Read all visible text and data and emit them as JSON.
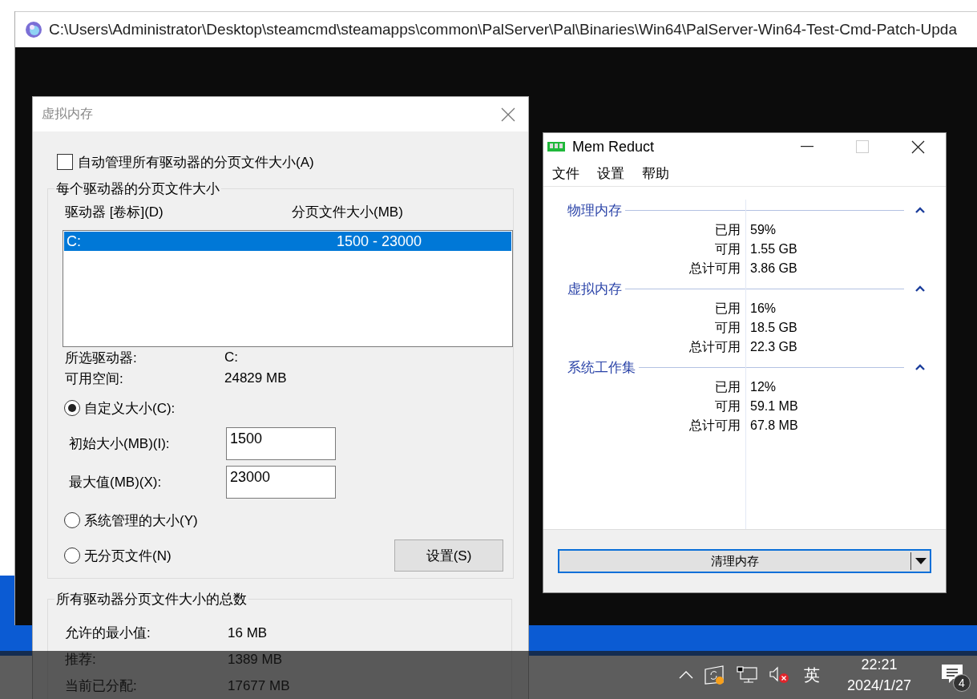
{
  "console_window": {
    "title": "C:\\Users\\Administrator\\Desktop\\steamcmd\\steamapps\\common\\PalServer\\Pal\\Binaries\\Win64\\PalServer-Win64-Test-Cmd-Patch-Upda"
  },
  "virtual_memory_dialog": {
    "title": "虚拟内存",
    "auto_manage": {
      "label": "自动管理所有驱动器的分页文件大小(A)",
      "checked": false
    },
    "per_drive": {
      "title": "每个驱动器的分页文件大小",
      "columns": [
        "驱动器 [卷标](D)",
        "分页文件大小(MB)"
      ],
      "rows": [
        {
          "drive": "C:",
          "size": "1500 - 23000",
          "selected": true
        }
      ],
      "info": [
        {
          "label": "所选驱动器:",
          "value": "C:"
        },
        {
          "label": "可用空间:",
          "value": "24829 MB"
        }
      ],
      "size_options": [
        {
          "label": "自定义大小(C):",
          "selected": true
        },
        {
          "label": "系统管理的大小(Y)",
          "selected": false
        },
        {
          "label": "无分页文件(N)",
          "selected": false
        }
      ],
      "fields": [
        {
          "label": "初始大小(MB)(I):",
          "value": "1500"
        },
        {
          "label": "最大值(MB)(X):",
          "value": "23000"
        }
      ],
      "set_button": "设置(S)"
    },
    "totals": {
      "title": "所有驱动器分页文件大小的总数",
      "rows": [
        {
          "label": "允许的最小值:",
          "value": "16 MB"
        },
        {
          "label": "推荐:",
          "value": "1389 MB"
        },
        {
          "label": "当前已分配:",
          "value": "17677 MB"
        }
      ]
    }
  },
  "mem_reduct": {
    "title": "Mem Reduct",
    "menu": [
      "文件",
      "设置",
      "帮助"
    ],
    "sections": [
      {
        "title": "物理内存",
        "expanded": true,
        "rows": [
          {
            "label": "已用",
            "value": "59%"
          },
          {
            "label": "可用",
            "value": "1.55 GB"
          },
          {
            "label": "总计可用",
            "value": "3.86 GB"
          }
        ]
      },
      {
        "title": "虚拟内存",
        "expanded": true,
        "rows": [
          {
            "label": "已用",
            "value": "16%"
          },
          {
            "label": "可用",
            "value": "18.5 GB"
          },
          {
            "label": "总计可用",
            "value": "22.3 GB"
          }
        ]
      },
      {
        "title": "系统工作集",
        "expanded": true,
        "rows": [
          {
            "label": "已用",
            "value": "12%"
          },
          {
            "label": "可用",
            "value": "59.1 MB"
          },
          {
            "label": "总计可用",
            "value": "67.8 MB"
          }
        ]
      }
    ],
    "clean_button": "清理内存"
  },
  "taskbar": {
    "ime": "英",
    "time": "22:21",
    "date": "2024/1/27",
    "notification_count": "4"
  }
}
